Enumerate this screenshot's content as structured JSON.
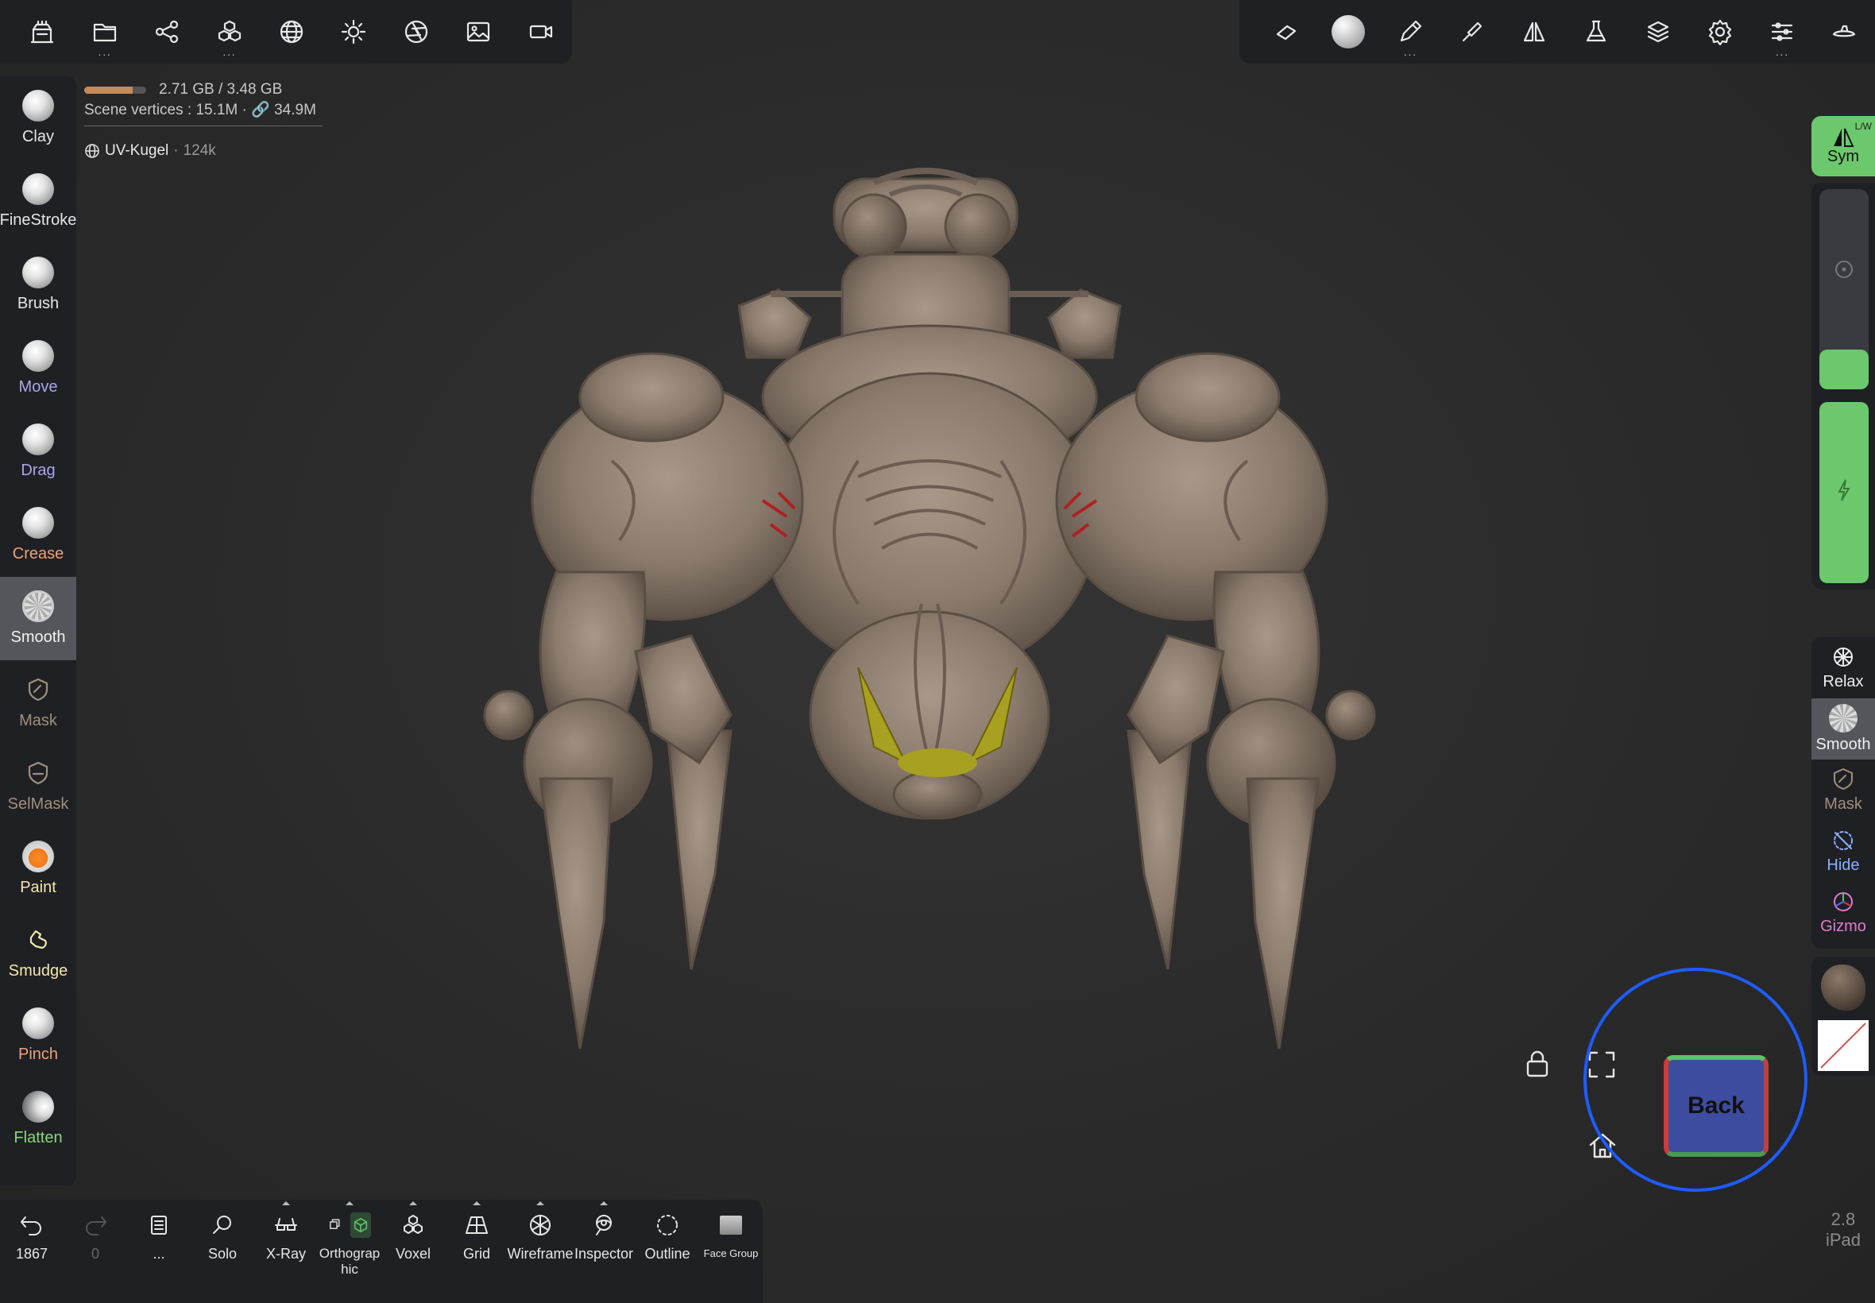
{
  "stats": {
    "memory": "2.71 GB / 3.48 GB",
    "memory_fraction": 0.78,
    "vertices_label": "Scene vertices :",
    "vertices": "15.1M",
    "linked": "34.9M",
    "object_name": "UV-Kugel",
    "object_count": "124k"
  },
  "left_tools": [
    {
      "label": "Clay",
      "color": "#e6e6e6"
    },
    {
      "label": "FineStroke",
      "color": "#e6e6e6"
    },
    {
      "label": "Brush",
      "color": "#e6e6e6"
    },
    {
      "label": "Move",
      "color": "#a9a6f0"
    },
    {
      "label": "Drag",
      "color": "#a9a6f0"
    },
    {
      "label": "Crease",
      "color": "#f0a07a"
    },
    {
      "label": "Smooth",
      "color": "#f2f2f2"
    },
    {
      "label": "Mask",
      "color": "#a08f7c"
    },
    {
      "label": "SelMask",
      "color": "#a08f7c"
    },
    {
      "label": "Paint",
      "color": "#f5e6a8"
    },
    {
      "label": "Smudge",
      "color": "#f5e6a8"
    },
    {
      "label": "Pinch",
      "color": "#f0a07a"
    },
    {
      "label": "Flatten",
      "color": "#8ad67a"
    }
  ],
  "right_tools": {
    "sym": "Sym",
    "sym_badge": "L/W",
    "relax": "Relax",
    "smooth": "Smooth",
    "mask": "Mask",
    "hide": "Hide",
    "gizmo": "Gizmo"
  },
  "right_sliders": {
    "radius_fraction": 0.2,
    "intensity_fraction": 1.0
  },
  "bottom_bar": {
    "undo": "1867",
    "redo": "0",
    "menu_dots": "...",
    "solo": "Solo",
    "xray": "X-Ray",
    "orthographic": "Orthograp hic",
    "voxel": "Voxel",
    "grid": "Grid",
    "wireframe": "Wireframe",
    "inspector": "Inspector",
    "outline": "Outline",
    "face_group": "Face Group"
  },
  "view_cube": {
    "label": "Back"
  },
  "version": {
    "number": "2.8",
    "device": "iPad"
  },
  "colors": {
    "accent_green": "#6cc86c",
    "view_ring": "#1e5cff",
    "panel_bg": "#1f2024",
    "model": "#8a7a6c"
  }
}
